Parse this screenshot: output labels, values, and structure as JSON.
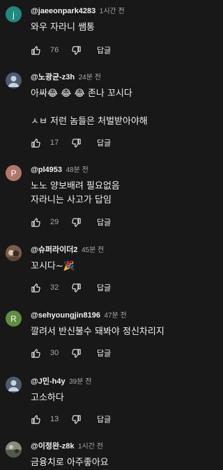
{
  "colors": {
    "background": "#181818",
    "text": "#f1f1f1",
    "secondary_text": "#aaaaaa"
  },
  "comments": [
    {
      "avatar_letter": "j",
      "avatar_color": "#1e8b7e",
      "author": "@jaeeonpark4283",
      "time": "1시간 전",
      "lines": [
        "와우 자라니 쌤통"
      ],
      "likes": "76",
      "reply_label": "답글"
    },
    {
      "avatar_letter": "",
      "avatar_color": "#4b5b70",
      "author": "@노광균-z3h",
      "time": "24분 전",
      "lines": [
        "아싸😂 😂 😂 존나 꼬시다",
        "",
        "ㅅㅂ 저런 놈들은 처벌받아야해"
      ],
      "likes": "17",
      "reply_label": "답글"
    },
    {
      "avatar_letter": "P",
      "avatar_color": "#b0776b",
      "author": "@pl4953",
      "time": "48분 전",
      "lines": [
        "노노 양보배려 필요없음",
        "자라니는 사고가 답임"
      ],
      "likes": "29",
      "reply_label": "답글"
    },
    {
      "avatar_letter": "",
      "avatar_color": "#6b5040",
      "author": "@슈퍼라이더2",
      "time": "45분 전",
      "lines": [
        "꼬시다~🎉"
      ],
      "likes": "32",
      "reply_label": "답글"
    },
    {
      "avatar_letter": "R",
      "avatar_color": "#5f8e3e",
      "author": "@sehyoungjin8196",
      "time": "47분 전",
      "lines": [
        "깔려서 반신불수 돼봐야 정신차리지"
      ],
      "likes": "30",
      "reply_label": "답글"
    },
    {
      "avatar_letter": "",
      "avatar_color": "#4b5b70",
      "author": "@J민-h4y",
      "time": "39분 전",
      "lines": [
        "고소하다"
      ],
      "likes": "13",
      "reply_label": "답글"
    },
    {
      "avatar_letter": "",
      "avatar_color": "#6e6e6e",
      "author": "@이정완-z8k",
      "time": "1시간 전",
      "lines": [
        "금융치로 아주좋아요"
      ],
      "likes": "",
      "reply_label": ""
    }
  ]
}
